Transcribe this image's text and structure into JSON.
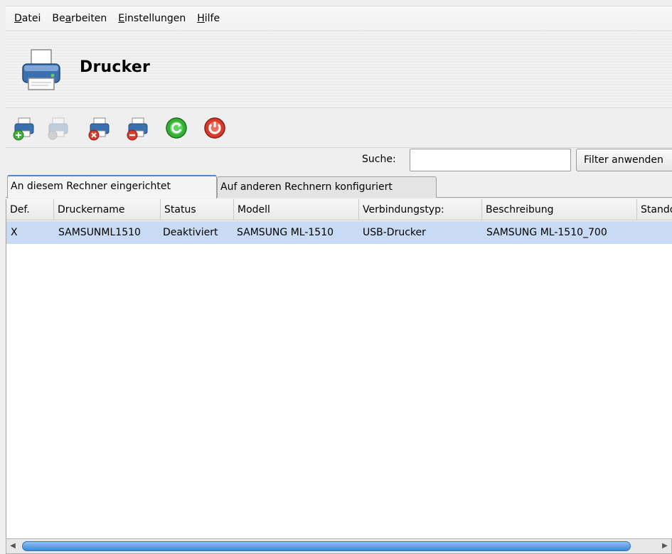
{
  "menu": {
    "file": {
      "pre": "",
      "acc": "D",
      "post": "atei"
    },
    "edit": {
      "pre": "Be",
      "acc": "a",
      "post": "rbeiten"
    },
    "settings": {
      "pre": "",
      "acc": "E",
      "post": "instellungen"
    },
    "help": {
      "pre": "",
      "acc": "H",
      "post": "ilfe"
    }
  },
  "banner": {
    "title": "Drucker",
    "icon": "printer-icon"
  },
  "toolbar": {
    "buttons": [
      {
        "icon": "add-printer-icon",
        "enabled": true
      },
      {
        "icon": "printer-settings-icon",
        "enabled": false
      },
      {
        "icon": "delete-printer-icon",
        "enabled": true
      },
      {
        "icon": "disable-printer-icon",
        "enabled": true
      },
      {
        "icon": "refresh-icon",
        "enabled": true
      },
      {
        "icon": "quit-icon",
        "enabled": true
      }
    ]
  },
  "search": {
    "label": "Suche:",
    "value": "",
    "filter_button": "Filter anwenden"
  },
  "tabs": [
    "An diesem Rechner eingerichtet",
    "Auf anderen Rechnern konfiguriert"
  ],
  "table": {
    "columns": [
      "Def.",
      "Druckername",
      "Status",
      "Modell",
      "Verbindungstyp:",
      "Beschreibung",
      "Standort"
    ],
    "rows": [
      [
        "X",
        "SAMSUNML1510",
        "Deaktiviert",
        "SAMSUNG ML-1510",
        "USB-Drucker",
        "SAMSUNG ML-1510_700",
        ""
      ]
    ]
  },
  "colors": {
    "accent": "#3c8ad8",
    "selection": "#c7dcf4"
  }
}
